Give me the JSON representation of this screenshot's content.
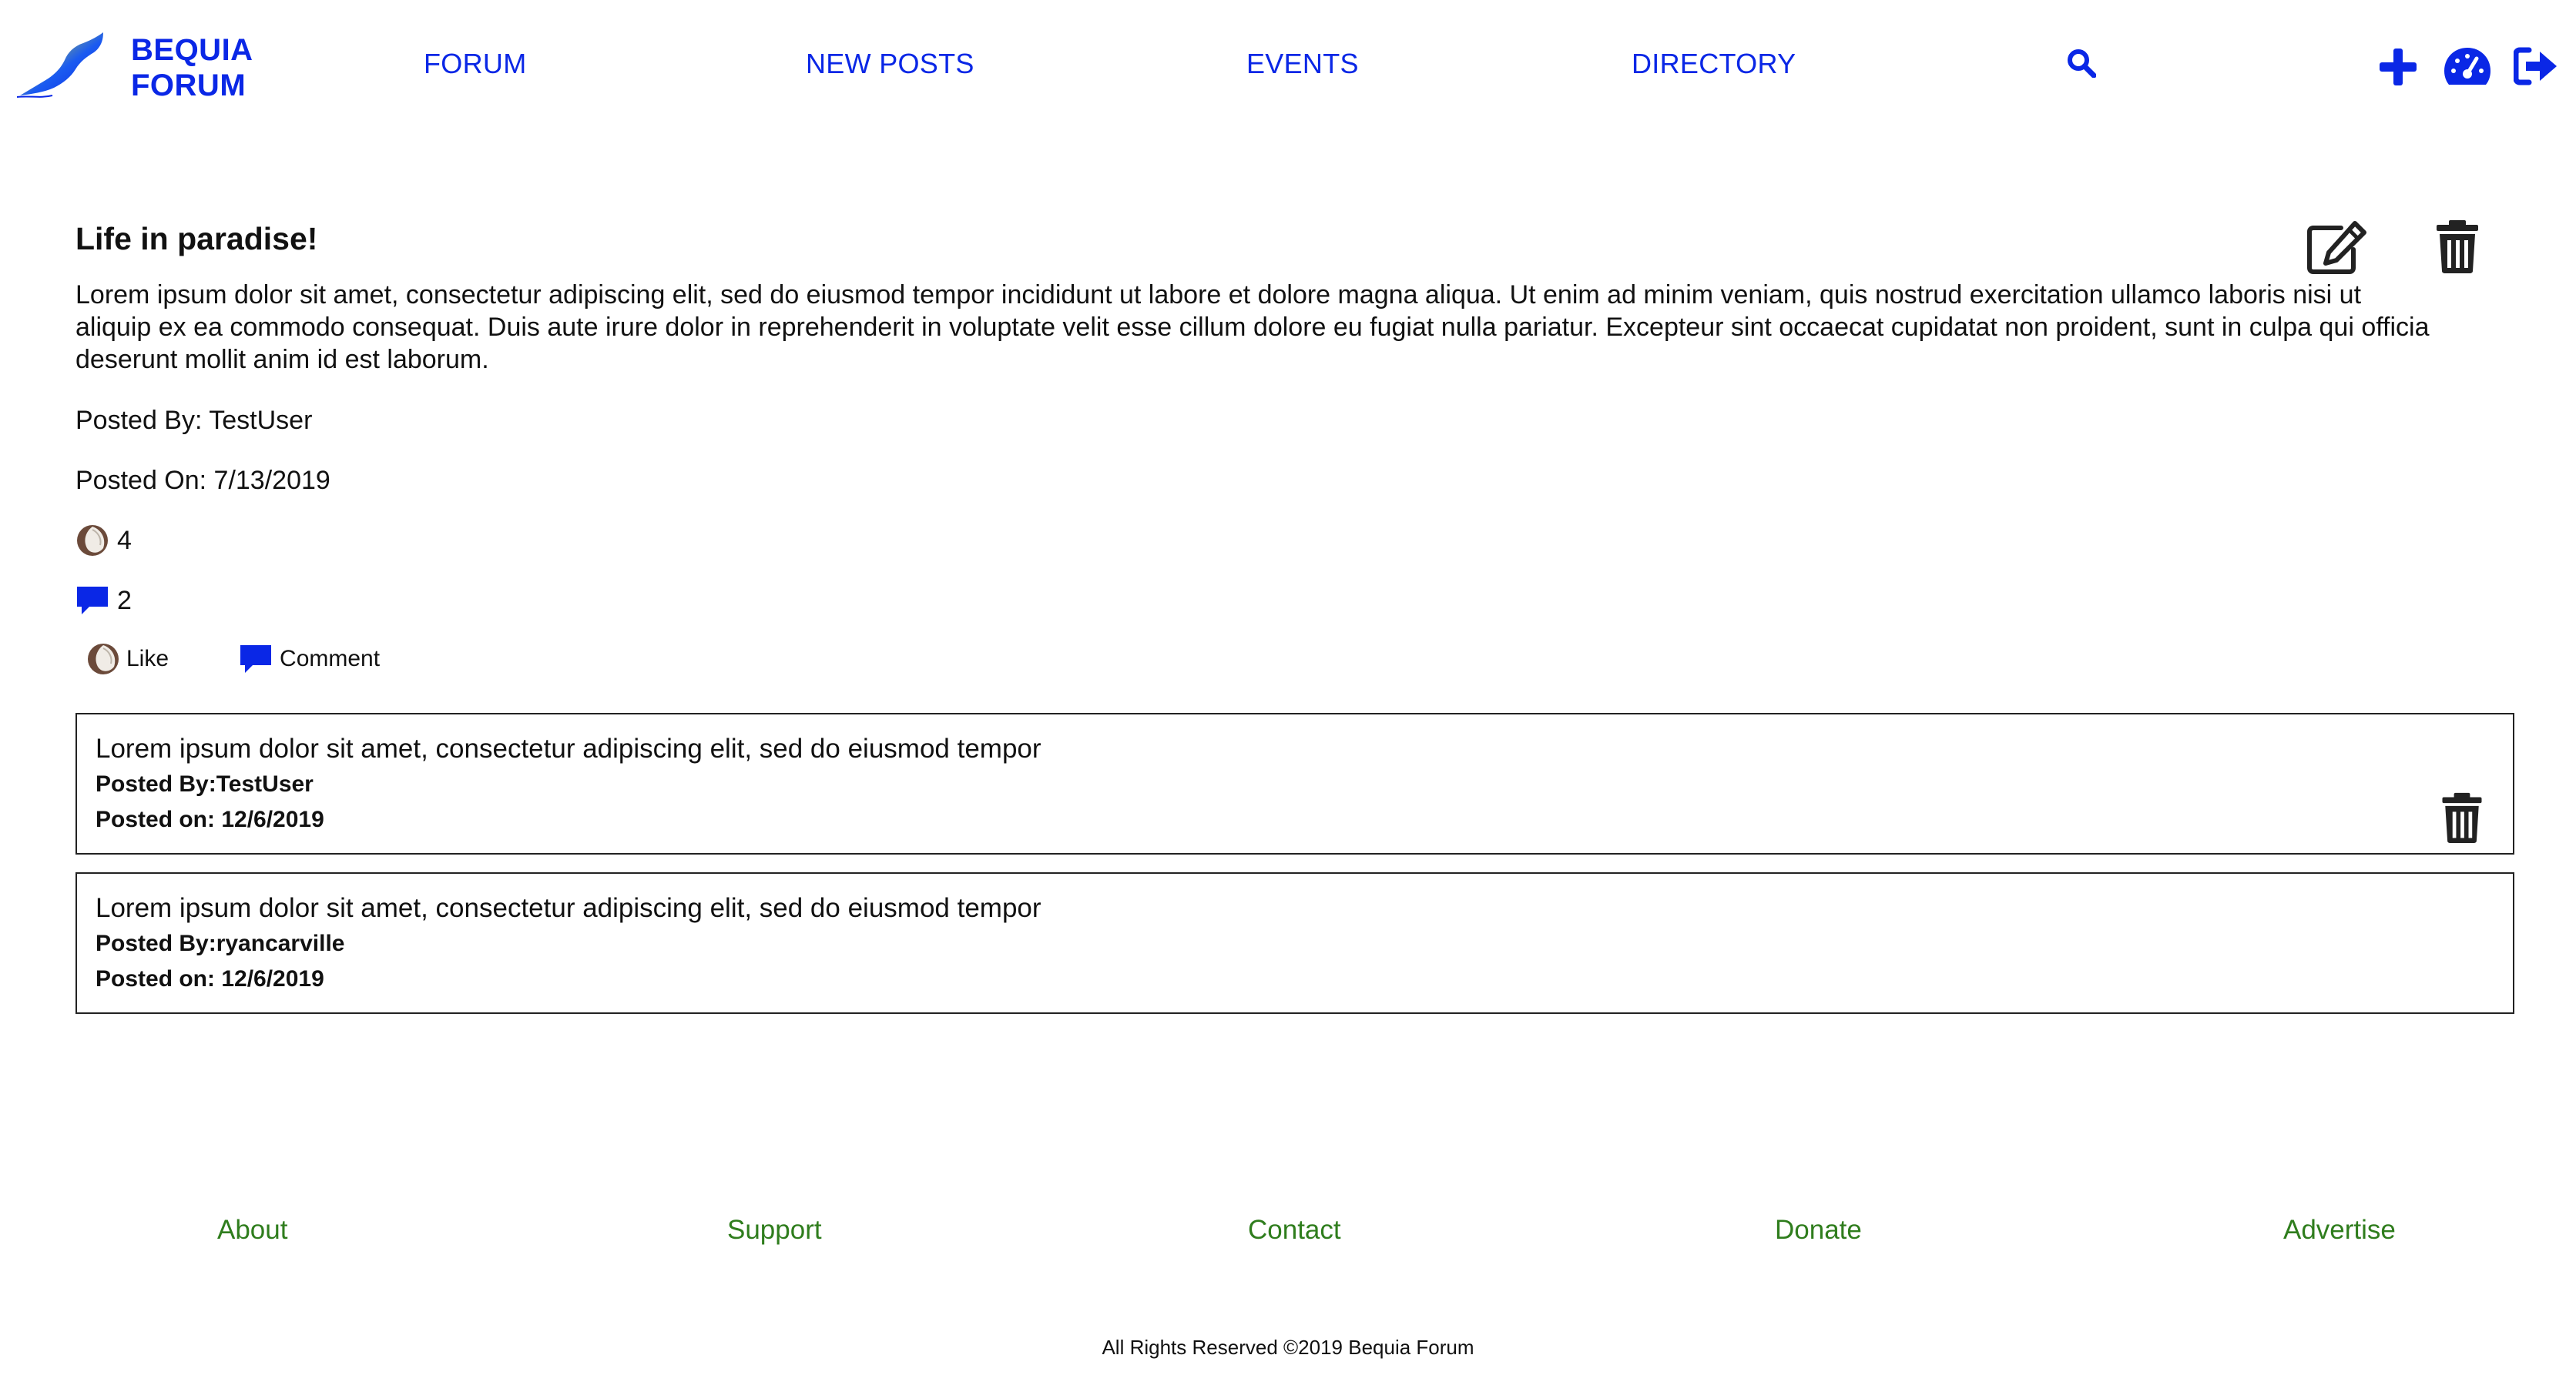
{
  "brand": {
    "line1": "BEQUIA",
    "line2": "FORUM"
  },
  "nav": {
    "items": [
      "FORUM",
      "NEW POSTS",
      "EVENTS",
      "DIRECTORY"
    ]
  },
  "post": {
    "title": "Life in paradise!",
    "body": "Lorem ipsum dolor sit amet, consectetur adipiscing elit, sed do eiusmod tempor incididunt ut labore et dolore magna aliqua. Ut enim ad minim veniam, quis nostrud exercitation ullamco laboris nisi ut aliquip ex ea commodo consequat. Duis aute irure dolor in reprehenderit in voluptate velit esse cillum dolore eu fugiat nulla pariatur. Excepteur sint occaecat cupidatat non proident, sunt in culpa qui officia deserunt mollit anim id est laborum.",
    "posted_by": "Posted By: TestUser",
    "posted_on": "Posted On: 7/13/2019",
    "like_count": "4",
    "comment_count": "2",
    "like_label": "Like",
    "comment_label": "Comment"
  },
  "comments": [
    {
      "text": "Lorem ipsum dolor sit amet, consectetur adipiscing elit, sed do eiusmod tempor",
      "posted_by": "Posted By:TestUser",
      "posted_on": "Posted on: 12/6/2019"
    },
    {
      "text": "Lorem ipsum dolor sit amet, consectetur adipiscing elit, sed do eiusmod tempor",
      "posted_by": "Posted By:ryancarville",
      "posted_on": "Posted on: 12/6/2019"
    }
  ],
  "footer": {
    "links": [
      "About",
      "Support",
      "Contact",
      "Donate",
      "Advertise"
    ],
    "copyright": "All Rights Reserved ©2019 Bequia Forum"
  },
  "icons": {
    "search": "search-icon",
    "add": "plus-icon",
    "dashboard": "dashboard-icon",
    "logout": "logout-icon",
    "edit": "edit-icon",
    "delete": "trash-icon",
    "like": "coconut-icon",
    "comment": "comment-icon"
  },
  "colors": {
    "brand_blue": "#0a27e6",
    "footer_green": "#2f7d1d"
  }
}
